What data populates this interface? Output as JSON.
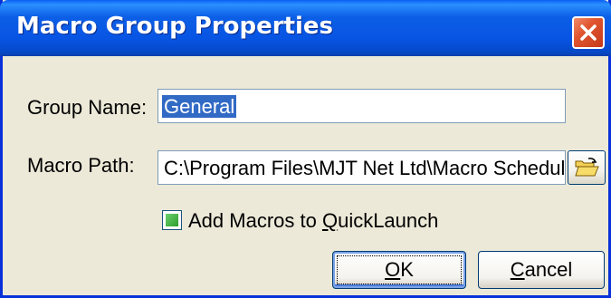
{
  "window": {
    "title": "Macro Group Properties",
    "close_icon": "close-x-icon"
  },
  "form": {
    "group_name_label": "Group Name:",
    "group_name_value": "General",
    "macro_path_label": "Macro Path:",
    "macro_path_value": "C:\\Program Files\\MJT Net Ltd\\Macro Schedul",
    "browse_icon": "open-folder-icon",
    "checkbox": {
      "label_before": "Add Macros to ",
      "label_mnemonic": "Q",
      "label_after": "uickLaunch",
      "checked": true
    }
  },
  "buttons": {
    "ok": {
      "mnemonic": "O",
      "rest": "K"
    },
    "cancel": {
      "mnemonic": "C",
      "rest": "ancel"
    }
  },
  "colors": {
    "titlebar": "#0854e3",
    "close": "#e0552f",
    "selection": "#316ac5",
    "checkbox_fill": "#2c9e2c"
  }
}
